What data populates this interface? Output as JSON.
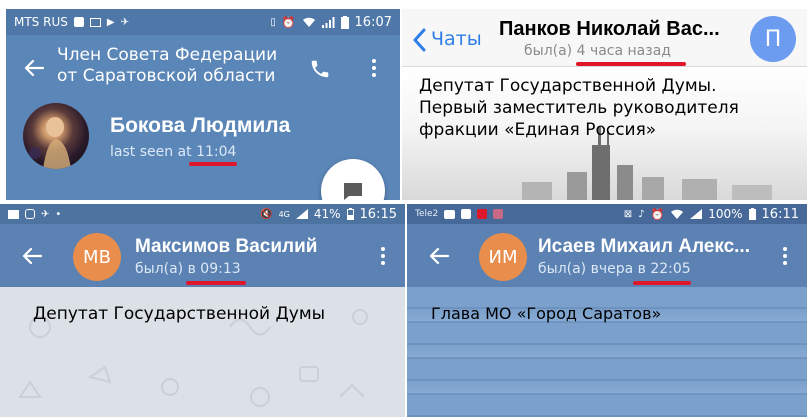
{
  "colors": {
    "header_blue": "#5b86b8",
    "header_blue_dark": "#527aa9",
    "accent_red": "#e0172a",
    "ios_blue": "#2f7ee8",
    "avatar_orange": "#e88d4c",
    "avatar_blue": "#6c9cf0"
  },
  "panels": [
    {
      "status": {
        "carrier": "MTS RUS",
        "time": "16:07"
      },
      "header_title": [
        "Член Совета Федерации",
        "от Саратовской области"
      ],
      "contact_name": "Бокова Людмила",
      "last_seen_prefix": "last seen at ",
      "last_seen_time": "11:04",
      "icons": [
        "back-arrow-icon",
        "phone-icon",
        "more-vert-icon",
        "chat-fab-icon"
      ]
    },
    {
      "back_label": "Чаты",
      "contact_name": "Панков Николай Вас...",
      "last_seen_prefix": "был(а) ",
      "last_seen_time": "4 часа назад",
      "avatar_initial": "П",
      "caption_lines": [
        "Депутат Государственной Думы.",
        "Первый заместитель руководителя",
        "фракции «Единая Россия»"
      ]
    },
    {
      "status": {
        "battery": "41%",
        "time": "16:15",
        "network": "4G"
      },
      "avatar_initials": "МВ",
      "contact_name": "Максимов Василий",
      "last_seen_prefix": "был(а) в ",
      "last_seen_time": "09:13",
      "caption": "Депутат Государственной Думы"
    },
    {
      "status": {
        "carrier": "Tele2",
        "battery": "100%",
        "time": "16:11"
      },
      "avatar_initials": "ИМ",
      "contact_name": "Исаев Михаил Алекс...",
      "last_seen_prefix": "был(а) вчера в ",
      "last_seen_time": "22:05",
      "caption": "Глава МО «Город Саратов»"
    }
  ]
}
